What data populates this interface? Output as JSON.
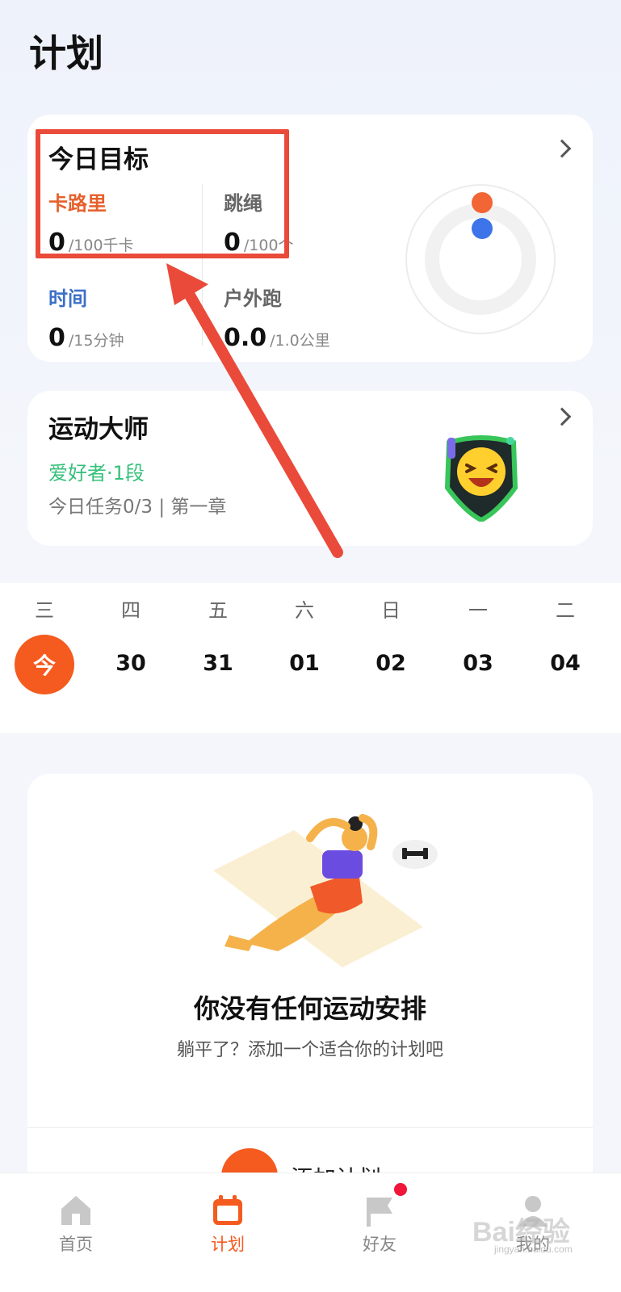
{
  "header": {
    "title": "计划"
  },
  "goal_card": {
    "title": "今日目标",
    "metrics": [
      {
        "label": "卡路里",
        "value": "0",
        "target": "/100千卡",
        "color": "#e5602b"
      },
      {
        "label": "跳绳",
        "value": "0",
        "target": "/100个",
        "color": "#666666"
      },
      {
        "label": "时间",
        "value": "0",
        "target": "/15分钟",
        "color": "#3b6fc8"
      },
      {
        "label": "户外跑",
        "value": "0.0",
        "target": "/1.0公里",
        "color": "#666666"
      }
    ],
    "ring_colors": {
      "outer": "#f26534",
      "inner": "#3d74e9"
    }
  },
  "master_card": {
    "title": "运动大师",
    "level": "爱好者·1段",
    "task": "今日任务0/3 | 第一章"
  },
  "week": {
    "days": [
      {
        "name": "三",
        "num": "今"
      },
      {
        "name": "四",
        "num": "30"
      },
      {
        "name": "五",
        "num": "31"
      },
      {
        "name": "六",
        "num": "01"
      },
      {
        "name": "日",
        "num": "02"
      },
      {
        "name": "一",
        "num": "03"
      },
      {
        "name": "二",
        "num": "04"
      }
    ]
  },
  "plan_card": {
    "empty_title": "你没有任何运动安排",
    "empty_subtitle": "躺平了？添加一个适合你的计划吧",
    "add_label": "添加计划"
  },
  "tabs": [
    {
      "label": "首页",
      "icon": "home-icon"
    },
    {
      "label": "计划",
      "icon": "calendar-icon"
    },
    {
      "label": "好友",
      "icon": "flag-icon"
    },
    {
      "label": "我的",
      "icon": "user-icon"
    }
  ],
  "accent_color": "#f55a1e",
  "watermark": {
    "main": "Bai经验",
    "sub": "jingyan.baidu.com"
  }
}
